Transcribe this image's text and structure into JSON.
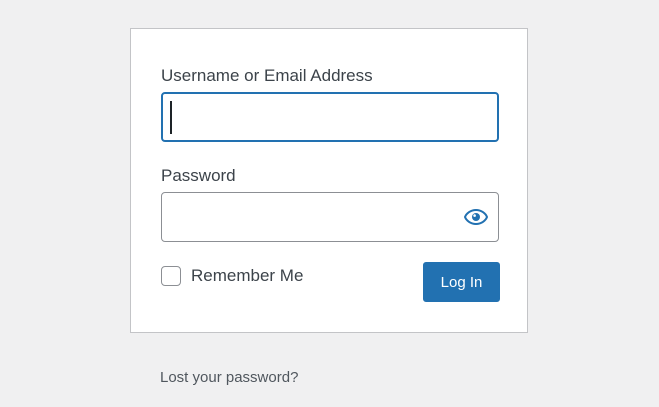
{
  "login_form": {
    "username_label": "Username or Email Address",
    "username_value": "",
    "password_label": "Password",
    "password_value": "",
    "show_password_icon": "eye-icon",
    "remember_me_label": "Remember Me",
    "remember_me_checked": false,
    "submit_label": "Log In"
  },
  "links": {
    "lost_password": "Lost your password?"
  },
  "colors": {
    "background": "#f0f0f1",
    "accent": "#2271b1",
    "text": "#3c434a"
  }
}
